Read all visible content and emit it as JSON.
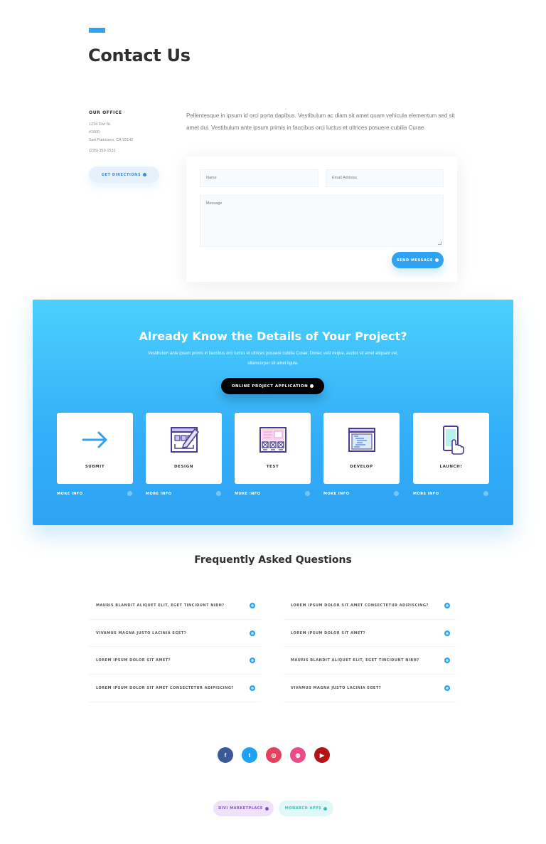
{
  "header": {
    "title": "Contact Us"
  },
  "office": {
    "heading": "OUR OFFICE",
    "address_lines": [
      "1234 Divi St.",
      "#1000",
      "San Francisco, CA 93142"
    ],
    "phone": "(235) 353-1531",
    "directions_label": "GET DIRECTIONS"
  },
  "intro": {
    "text": "Pellentesque in ipsum id orci porta dapibus. Vestibulum ac diam sit amet quam vehicula elementum sed sit amet dui. Vestibulum ante ipsum primis in faucibus orci luctus et ultrices posuere cubilia Curae"
  },
  "form": {
    "name_placeholder": "Name",
    "email_placeholder": "Email Address",
    "message_placeholder": "Message",
    "submit_label": "SEND MESSAGE"
  },
  "project": {
    "title": "Already Know the Details of Your Project?",
    "subtitle": "Vestibulum ante ipsum primis in faucibus orci luctus et ultrices posuere cubilia Curae; Donec velit neque, auctor sit amet aliquam vel, ullamcorper sit amet ligula.",
    "button_label": "ONLINE PROJECT APPLICATION",
    "steps": [
      {
        "label": "SUBMIT",
        "icon": "arrow-right-icon",
        "more": "MORE INFO"
      },
      {
        "label": "DESIGN",
        "icon": "design-pencil-icon",
        "more": "MORE INFO"
      },
      {
        "label": "TEST",
        "icon": "test-layout-icon",
        "more": "MORE INFO"
      },
      {
        "label": "DEVELOP",
        "icon": "code-window-icon",
        "more": "MORE INFO"
      },
      {
        "label": "LAUNCH!",
        "icon": "tap-phone-icon",
        "more": "MORE INFO"
      }
    ]
  },
  "faq": {
    "title": "Frequently Asked Questions",
    "left": [
      "MAURIS BLANDIT ALIQUET ELIT, EGET TINCIDUNT NIBH?",
      "VIVAMUS MAGNA JUSTO LACINIA EGET?",
      "LOREM IPSUM DOLOR SIT AMET?",
      "LOREM IPSUM DOLOR SIT AMET CONSECTETUR ADIPISCING?"
    ],
    "right": [
      "LOREM IPSUM DOLOR SIT AMET CONSECTETUR ADIPISCING?",
      "LOREM IPSUM DOLOR SIT AMET?",
      "MAURIS BLANDIT ALIQUET ELIT, EGET TINCIDUNT NIBH?",
      "VIVAMUS MAGNA JUSTO LACINIA EGET?"
    ]
  },
  "social": [
    {
      "name": "facebook-icon",
      "glyph": "f",
      "color": "#3b5998"
    },
    {
      "name": "twitter-icon",
      "glyph": "t",
      "color": "#1da1f2"
    },
    {
      "name": "instagram-icon",
      "glyph": "◎",
      "color": "#e4405f"
    },
    {
      "name": "dribbble-icon",
      "glyph": "◍",
      "color": "#ea4c89"
    },
    {
      "name": "youtube-icon",
      "glyph": "▶",
      "color": "#b31217"
    }
  ],
  "footer": {
    "divi_label": "DIVI MARKETPLACE",
    "monarch_label": "MONARCH APPS"
  },
  "colors": {
    "accent": "#2ea3f2",
    "gradient_top": "#4bd0fd",
    "gradient_bottom": "#2ea3f2"
  }
}
